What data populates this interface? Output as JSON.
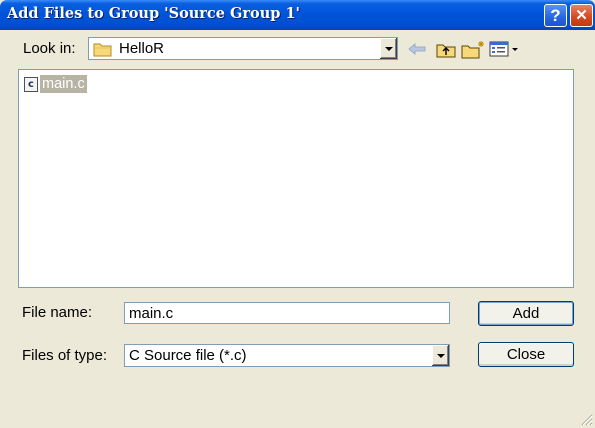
{
  "window": {
    "title": "Add Files to Group 'Source Group 1'",
    "help_glyph": "?",
    "close_glyph": "✕",
    "titlebar_color": "#0053D8",
    "background_color": "#ECE9D8"
  },
  "look_in": {
    "label": "Look in:",
    "folder_icon": "folder-icon",
    "value": "HelloR"
  },
  "toolbar": {
    "icons": [
      "back-arrow-icon",
      "up-folder-icon",
      "new-folder-icon",
      "view-menu-icon"
    ]
  },
  "file_list": {
    "items": [
      {
        "name": "main.c",
        "icon": "c-source-file-icon",
        "icon_glyph": "c",
        "selected": true
      }
    ]
  },
  "file_name": {
    "label": "File name:",
    "value": "main.c"
  },
  "files_of_type": {
    "label": "Files of type:",
    "value": "C Source file (*.c)"
  },
  "buttons": {
    "add": "Add",
    "close": "Close"
  }
}
